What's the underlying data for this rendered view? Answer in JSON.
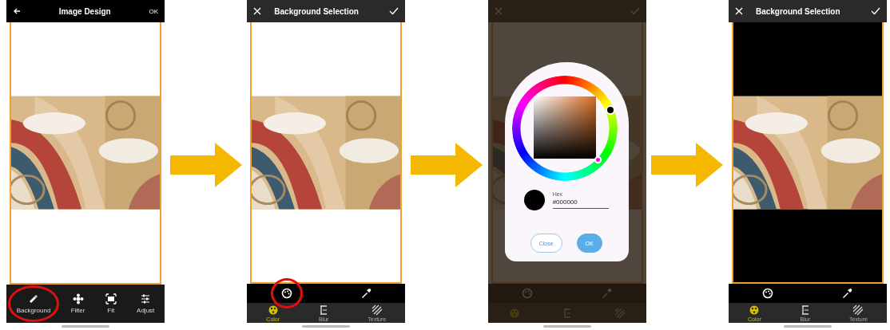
{
  "screens": [
    {
      "kind": "main",
      "header": {
        "title": "Image Design",
        "action": "OK"
      },
      "tools": [
        {
          "label": "Background",
          "annotated": true
        },
        {
          "label": "Filter"
        },
        {
          "label": "Fit"
        },
        {
          "label": "Adjust"
        }
      ]
    },
    {
      "kind": "background",
      "header": {
        "title": "Background Selection"
      },
      "palette_annotated": true,
      "tabs": [
        {
          "label": "Color",
          "selected": true
        },
        {
          "label": "Blur",
          "selected": false
        },
        {
          "label": "Texture",
          "selected": false
        }
      ]
    },
    {
      "kind": "background",
      "dimmed": true,
      "dialog": {
        "hex_label": "Hex",
        "hex_value": "#000000",
        "buttons": [
          {
            "label": "Close",
            "kind": "outline"
          },
          {
            "label": "OK",
            "kind": "filled"
          }
        ]
      }
    },
    {
      "kind": "background",
      "header": {
        "title": "Background Selection"
      },
      "color_applied": true,
      "tabs": [
        {
          "label": "Color",
          "selected": true
        },
        {
          "label": "Blur",
          "selected": false
        },
        {
          "label": "Texture",
          "selected": false
        }
      ]
    }
  ]
}
